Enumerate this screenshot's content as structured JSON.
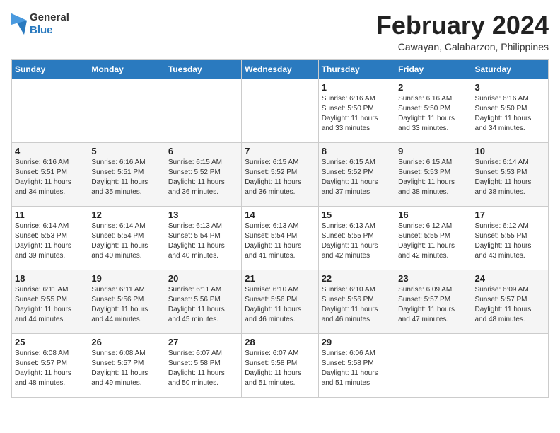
{
  "logo": {
    "text_general": "General",
    "text_blue": "Blue"
  },
  "title": "February 2024",
  "subtitle": "Cawayan, Calabarzon, Philippines",
  "days_of_week": [
    "Sunday",
    "Monday",
    "Tuesday",
    "Wednesday",
    "Thursday",
    "Friday",
    "Saturday"
  ],
  "weeks": [
    [
      {
        "day": "",
        "info": ""
      },
      {
        "day": "",
        "info": ""
      },
      {
        "day": "",
        "info": ""
      },
      {
        "day": "",
        "info": ""
      },
      {
        "day": "1",
        "info": "Sunrise: 6:16 AM\nSunset: 5:50 PM\nDaylight: 11 hours\nand 33 minutes."
      },
      {
        "day": "2",
        "info": "Sunrise: 6:16 AM\nSunset: 5:50 PM\nDaylight: 11 hours\nand 33 minutes."
      },
      {
        "day": "3",
        "info": "Sunrise: 6:16 AM\nSunset: 5:50 PM\nDaylight: 11 hours\nand 34 minutes."
      }
    ],
    [
      {
        "day": "4",
        "info": "Sunrise: 6:16 AM\nSunset: 5:51 PM\nDaylight: 11 hours\nand 34 minutes."
      },
      {
        "day": "5",
        "info": "Sunrise: 6:16 AM\nSunset: 5:51 PM\nDaylight: 11 hours\nand 35 minutes."
      },
      {
        "day": "6",
        "info": "Sunrise: 6:15 AM\nSunset: 5:52 PM\nDaylight: 11 hours\nand 36 minutes."
      },
      {
        "day": "7",
        "info": "Sunrise: 6:15 AM\nSunset: 5:52 PM\nDaylight: 11 hours\nand 36 minutes."
      },
      {
        "day": "8",
        "info": "Sunrise: 6:15 AM\nSunset: 5:52 PM\nDaylight: 11 hours\nand 37 minutes."
      },
      {
        "day": "9",
        "info": "Sunrise: 6:15 AM\nSunset: 5:53 PM\nDaylight: 11 hours\nand 38 minutes."
      },
      {
        "day": "10",
        "info": "Sunrise: 6:14 AM\nSunset: 5:53 PM\nDaylight: 11 hours\nand 38 minutes."
      }
    ],
    [
      {
        "day": "11",
        "info": "Sunrise: 6:14 AM\nSunset: 5:53 PM\nDaylight: 11 hours\nand 39 minutes."
      },
      {
        "day": "12",
        "info": "Sunrise: 6:14 AM\nSunset: 5:54 PM\nDaylight: 11 hours\nand 40 minutes."
      },
      {
        "day": "13",
        "info": "Sunrise: 6:13 AM\nSunset: 5:54 PM\nDaylight: 11 hours\nand 40 minutes."
      },
      {
        "day": "14",
        "info": "Sunrise: 6:13 AM\nSunset: 5:54 PM\nDaylight: 11 hours\nand 41 minutes."
      },
      {
        "day": "15",
        "info": "Sunrise: 6:13 AM\nSunset: 5:55 PM\nDaylight: 11 hours\nand 42 minutes."
      },
      {
        "day": "16",
        "info": "Sunrise: 6:12 AM\nSunset: 5:55 PM\nDaylight: 11 hours\nand 42 minutes."
      },
      {
        "day": "17",
        "info": "Sunrise: 6:12 AM\nSunset: 5:55 PM\nDaylight: 11 hours\nand 43 minutes."
      }
    ],
    [
      {
        "day": "18",
        "info": "Sunrise: 6:11 AM\nSunset: 5:55 PM\nDaylight: 11 hours\nand 44 minutes."
      },
      {
        "day": "19",
        "info": "Sunrise: 6:11 AM\nSunset: 5:56 PM\nDaylight: 11 hours\nand 44 minutes."
      },
      {
        "day": "20",
        "info": "Sunrise: 6:11 AM\nSunset: 5:56 PM\nDaylight: 11 hours\nand 45 minutes."
      },
      {
        "day": "21",
        "info": "Sunrise: 6:10 AM\nSunset: 5:56 PM\nDaylight: 11 hours\nand 46 minutes."
      },
      {
        "day": "22",
        "info": "Sunrise: 6:10 AM\nSunset: 5:56 PM\nDaylight: 11 hours\nand 46 minutes."
      },
      {
        "day": "23",
        "info": "Sunrise: 6:09 AM\nSunset: 5:57 PM\nDaylight: 11 hours\nand 47 minutes."
      },
      {
        "day": "24",
        "info": "Sunrise: 6:09 AM\nSunset: 5:57 PM\nDaylight: 11 hours\nand 48 minutes."
      }
    ],
    [
      {
        "day": "25",
        "info": "Sunrise: 6:08 AM\nSunset: 5:57 PM\nDaylight: 11 hours\nand 48 minutes."
      },
      {
        "day": "26",
        "info": "Sunrise: 6:08 AM\nSunset: 5:57 PM\nDaylight: 11 hours\nand 49 minutes."
      },
      {
        "day": "27",
        "info": "Sunrise: 6:07 AM\nSunset: 5:58 PM\nDaylight: 11 hours\nand 50 minutes."
      },
      {
        "day": "28",
        "info": "Sunrise: 6:07 AM\nSunset: 5:58 PM\nDaylight: 11 hours\nand 51 minutes."
      },
      {
        "day": "29",
        "info": "Sunrise: 6:06 AM\nSunset: 5:58 PM\nDaylight: 11 hours\nand 51 minutes."
      },
      {
        "day": "",
        "info": ""
      },
      {
        "day": "",
        "info": ""
      }
    ]
  ]
}
